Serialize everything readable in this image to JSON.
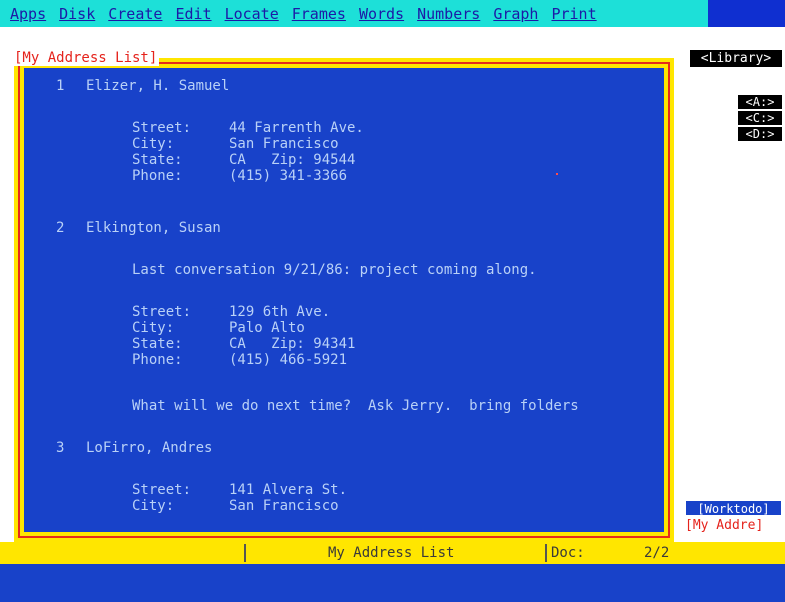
{
  "menu": {
    "items": [
      "Apps",
      "Disk",
      "Create",
      "Edit",
      "Locate",
      "Frames",
      "Words",
      "Numbers",
      "Graph",
      "Print"
    ]
  },
  "document": {
    "title": "[My Address List]",
    "entries": [
      {
        "number": "1",
        "name": "Elizer, H. Samuel",
        "fields": [
          {
            "label": "Street:",
            "value": "44 Farrenth Ave."
          },
          {
            "label": "City:",
            "value": "San Francisco"
          },
          {
            "label": "State:",
            "value": "CA   Zip: 94544"
          },
          {
            "label": "Phone:",
            "value": "(415) 341-3366"
          }
        ]
      },
      {
        "number": "2",
        "name": "Elkington, Susan",
        "note_before": "Last conversation 9/21/86: project coming along.",
        "fields": [
          {
            "label": "Street:",
            "value": "129 6th Ave."
          },
          {
            "label": "City:",
            "value": "Palo Alto"
          },
          {
            "label": "State:",
            "value": "CA   Zip: 94341"
          },
          {
            "label": "Phone:",
            "value": "(415) 466-5921"
          }
        ],
        "note_after": "What will we do next time?  Ask Jerry.  bring folders"
      },
      {
        "number": "3",
        "name": "LoFirro, Andres",
        "fields": [
          {
            "label": "Street:",
            "value": "141 Alvera St."
          },
          {
            "label": "City:",
            "value": "San Francisco"
          }
        ]
      }
    ]
  },
  "sidepanel": {
    "library_label": "<Library>",
    "drives": [
      "<A:>",
      "<C:>",
      "<D:>"
    ],
    "worktodo_label": "[Worktodo]",
    "window_tag": "[My Addre]"
  },
  "statusbar": {
    "doc_title": "My Address List",
    "doc_label": "Doc:",
    "pages": "2/2"
  },
  "colors": {
    "menubar_bg": "#1de0d8",
    "menu_text": "#1d1aa6",
    "frame_yellow": "#ffe600",
    "frame_red": "#e52b1c",
    "doc_bg": "#1842c9",
    "doc_text": "#b9d1f7"
  }
}
